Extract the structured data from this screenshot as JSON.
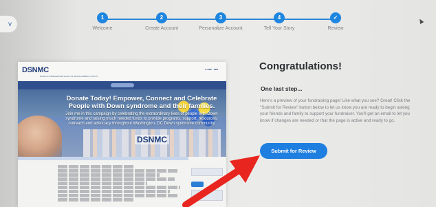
{
  "nav": {
    "back_label": "v"
  },
  "steps": [
    {
      "number": "1",
      "label": "Welcome",
      "state": "complete"
    },
    {
      "number": "2",
      "label": "Create Account",
      "state": "complete"
    },
    {
      "number": "3",
      "label": "Personalize Account",
      "state": "complete"
    },
    {
      "number": "4",
      "label": "Tell Your Story",
      "state": "complete"
    },
    {
      "number": "",
      "label": "Review",
      "state": "current"
    }
  ],
  "preview": {
    "logo": "DSNMC",
    "logo_sub": "DOWN SYNDROME NETWORK OF MONTGOMERY COUNTY",
    "hero_title": "Donate Today! Empower, Connect and Celebrate People with Down syndrome and their families.",
    "hero_body": "Join me in this campaign by celebrating the extraordinary lives of people with Down syndrome and raising much needed funds to provide programs, support, resources, outreach and advocacy throughout Washington, DC Down syndrome community",
    "hero_logo": "DSNMC"
  },
  "main": {
    "title": "Congratulations!",
    "subtitle": "One last step...",
    "description": "Here's a preview of your fundraising page! Like what you see? Great! Click the \"Submit for Review\" button below to let us know you are ready to begin asking your friends and family to support your fundraiser. You'll get an email to let you know if changes are needed or that the page is active and ready to go.",
    "submit_label": "Submit for Review"
  },
  "colors": {
    "accent": "#1f7fe0",
    "arrow": "#e8261f",
    "text_dark": "#2c2f33",
    "text_muted": "#7b7f84"
  }
}
